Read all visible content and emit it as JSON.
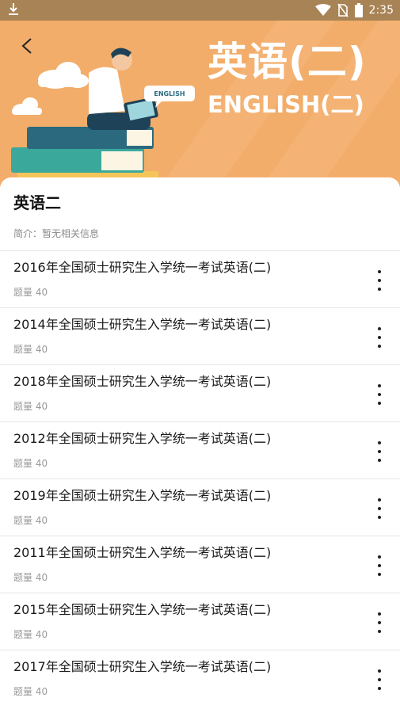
{
  "status_bar": {
    "time": "2:35",
    "icons": [
      "download-icon",
      "wifi-icon",
      "no-sim-icon",
      "battery-icon"
    ]
  },
  "header": {
    "title": "英语(二)",
    "subtitle": "ENGLISH(二)",
    "illustration_bubble_text": "ENGLISH",
    "back_icon": "back-arrow-icon"
  },
  "book": {
    "name": "英语二",
    "intro": "简介：暂无相关信息"
  },
  "exams": [
    {
      "title": "2016年全国硕士研究生入学统一考试英语(二)",
      "count": "题量 40"
    },
    {
      "title": "2014年全国硕士研究生入学统一考试英语(二)",
      "count": "题量 40"
    },
    {
      "title": "2018年全国硕士研究生入学统一考试英语(二)",
      "count": "题量 40"
    },
    {
      "title": "2012年全国硕士研究生入学统一考试英语(二)",
      "count": "题量 40"
    },
    {
      "title": "2019年全国硕士研究生入学统一考试英语(二)",
      "count": "题量 40"
    },
    {
      "title": "2011年全国硕士研究生入学统一考试英语(二)",
      "count": "题量 40"
    },
    {
      "title": "2015年全国硕士研究生入学统一考试英语(二)",
      "count": "题量 40"
    },
    {
      "title": "2017年全国硕士研究生入学统一考试英语(二)",
      "count": "题量 40"
    }
  ],
  "colors": {
    "banner": "#f3ad6a",
    "status_bar": "#a88355",
    "text_primary": "#1a1a1a",
    "text_secondary": "#9a9a9a"
  }
}
